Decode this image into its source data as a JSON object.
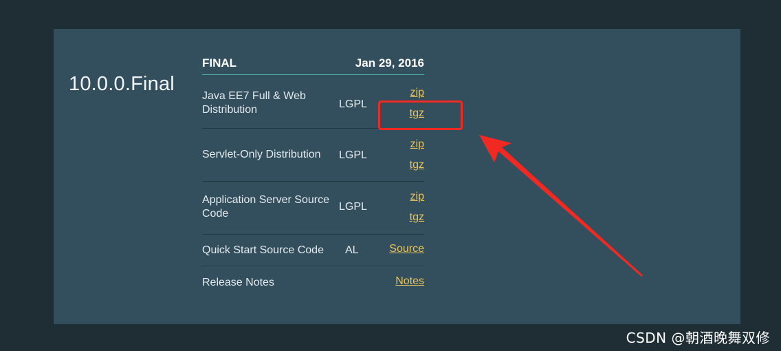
{
  "release": {
    "version": "10.0.0.Final",
    "status_label": "FINAL",
    "date": "Jan 29, 2016"
  },
  "downloads": [
    {
      "name": "Java EE7 Full & Web Distribution",
      "license": "LGPL",
      "links": [
        "zip",
        "tgz"
      ]
    },
    {
      "name": "Servlet-Only Distribution",
      "license": "LGPL",
      "links": [
        "zip",
        "tgz"
      ]
    },
    {
      "name": "Application Server Source Code",
      "license": "LGPL",
      "links": [
        "zip",
        "tgz"
      ]
    },
    {
      "name": "Quick Start Source Code",
      "license": "AL",
      "links": [
        "Source"
      ]
    },
    {
      "name": "Release Notes",
      "license": "",
      "links": [
        "Notes"
      ]
    }
  ],
  "annotation": {
    "color": "#f02a22"
  },
  "watermark": "CSDN @朝酒晚舞双修",
  "colors": {
    "page_bg": "#1f2d35",
    "panel_bg": "#334f5d",
    "link": "#e8c45a",
    "header_rule": "#4fb5a6"
  }
}
